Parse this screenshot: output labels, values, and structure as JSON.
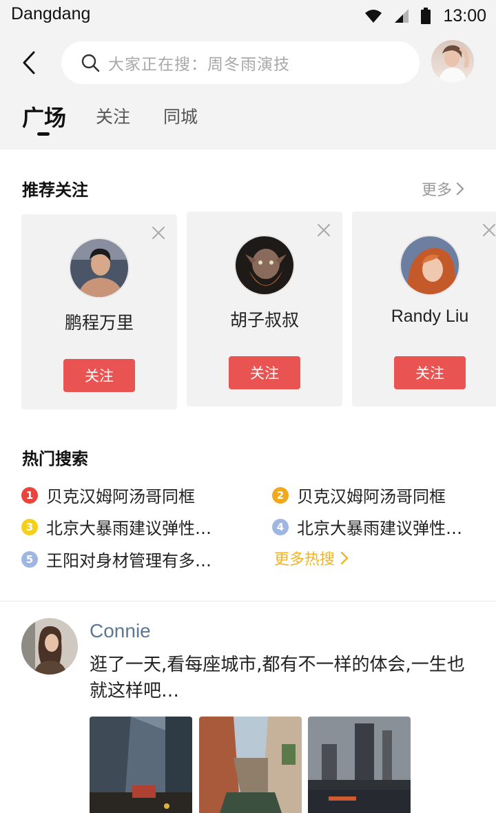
{
  "status_bar": {
    "carrier": "Dangdang",
    "time": "13:00"
  },
  "search": {
    "placeholder": "大家正在搜：周冬雨演技"
  },
  "tabs": [
    {
      "label": "广场",
      "active": true
    },
    {
      "label": "关注",
      "active": false
    },
    {
      "label": "同城",
      "active": false
    }
  ],
  "recommend": {
    "title": "推荐关注",
    "more_label": "更多",
    "cards": [
      {
        "name": "鹏程万里",
        "follow_label": "关注"
      },
      {
        "name": "胡子叔叔",
        "follow_label": "关注"
      },
      {
        "name": "Randy Liu",
        "follow_label": "关注"
      }
    ]
  },
  "hot_search": {
    "title": "热门搜索",
    "items": [
      {
        "rank": "1",
        "text": "贝克汉姆阿汤哥同框",
        "color": "#e8453c"
      },
      {
        "rank": "2",
        "text": "贝克汉姆阿汤哥同框",
        "color": "#f0a81c"
      },
      {
        "rank": "3",
        "text": "北京大暴雨建议弹性…",
        "color": "#f4cf1c"
      },
      {
        "rank": "4",
        "text": "北京大暴雨建议弹性…",
        "color": "#9fb6e3"
      },
      {
        "rank": "5",
        "text": "王阳对身材管理有多…",
        "color": "#9fb6e3"
      }
    ],
    "more_label": "更多热搜"
  },
  "post": {
    "username": "Connie",
    "text": "逛了一天,看每座城市,都有不一样的体会,一生也就这样吧…"
  },
  "colors": {
    "accent_red": "#e95452",
    "link_blue": "#5d7790",
    "hot_more": "#f2b321"
  }
}
